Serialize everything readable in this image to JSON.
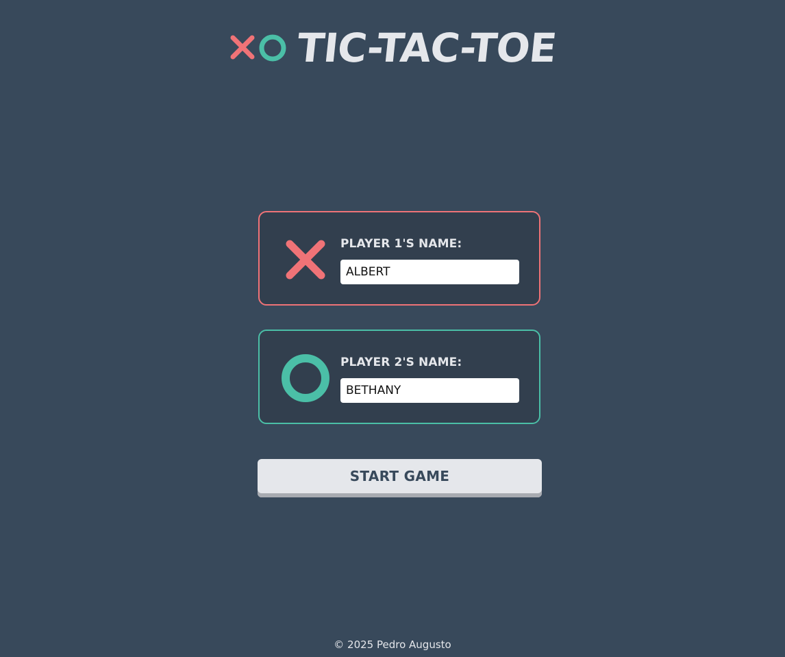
{
  "header": {
    "title": "TIC-TAC-TOE",
    "logo_icons": [
      "x-icon",
      "o-icon"
    ]
  },
  "colors": {
    "background": "#38495b",
    "card_background": "#323f4e",
    "x_color": "#f07377",
    "o_color": "#4bbfa7",
    "light": "#e5e7eb"
  },
  "player1": {
    "label": "PLAYER 1'S NAME:",
    "name_value": "ALBERT",
    "mark_icon": "x-icon"
  },
  "player2": {
    "label": "PLAYER 2'S NAME:",
    "name_value": "BETHANY",
    "mark_icon": "o-icon"
  },
  "start_button": {
    "label": "START GAME"
  },
  "footer": {
    "copyright": "© 2025 Pedro Augusto"
  }
}
